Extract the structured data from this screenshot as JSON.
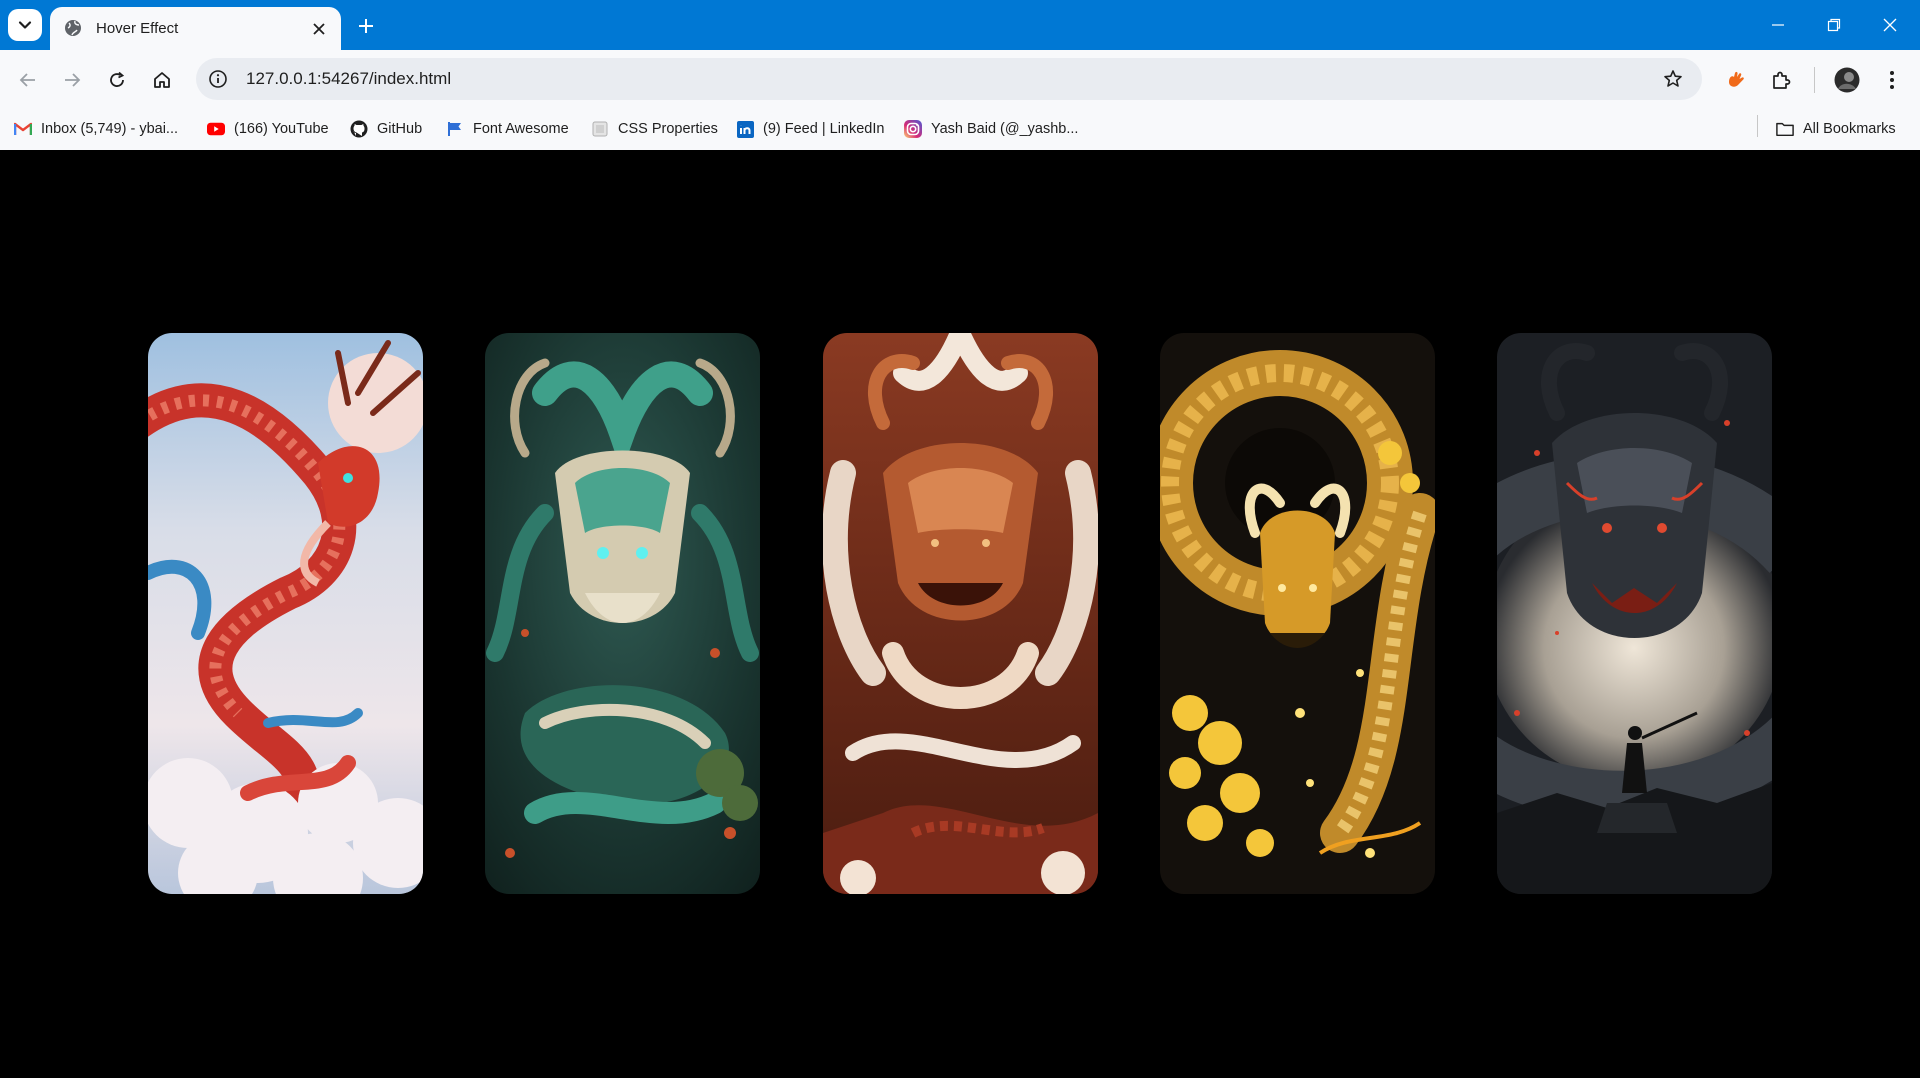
{
  "browser": {
    "tab": {
      "title": "Hover Effect",
      "favicon": "globe-icon"
    },
    "url": "127.0.0.1:54267/index.html",
    "bookmarks": [
      {
        "label": "Inbox (5,749) - ybai...",
        "icon": "gmail-icon"
      },
      {
        "label": "(166) YouTube",
        "icon": "youtube-icon"
      },
      {
        "label": "GitHub",
        "icon": "github-icon"
      },
      {
        "label": "Font Awesome",
        "icon": "font-awesome-icon"
      },
      {
        "label": "CSS Properties",
        "icon": "page-icon"
      },
      {
        "label": "(9) Feed | LinkedIn",
        "icon": "linkedin-icon"
      },
      {
        "label": "Yash Baid (@_yashb...",
        "icon": "instagram-icon"
      }
    ],
    "all_bookmarks_label": "All Bookmarks"
  },
  "gallery": {
    "cards": [
      {
        "name": "red-dragon",
        "colors": [
          "#8fb3d8",
          "#d23a2a",
          "#f0e4e4"
        ]
      },
      {
        "name": "green-dragon",
        "colors": [
          "#1d3a35",
          "#3e9d88",
          "#d9d0b8"
        ]
      },
      {
        "name": "brown-dragon",
        "colors": [
          "#6a2a18",
          "#c46a3a",
          "#efd9c4"
        ]
      },
      {
        "name": "gold-dragon",
        "colors": [
          "#1a1510",
          "#d69a28",
          "#f4d56a"
        ]
      },
      {
        "name": "black-dragon",
        "colors": [
          "#1c1f24",
          "#4a4f58",
          "#e0d8cc"
        ]
      }
    ]
  }
}
